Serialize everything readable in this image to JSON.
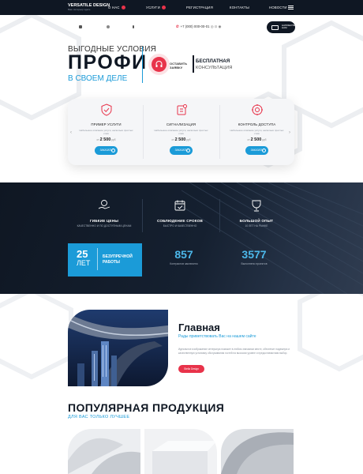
{
  "header": {
    "brand": "VERSATILE DESIGN",
    "brand_sub": "Ваш интерьер здесь",
    "nav": [
      {
        "label": "О НАС",
        "badge": true
      },
      {
        "label": "УСЛУГИ",
        "badge": true
      },
      {
        "label": "РЕГИСТРАЦИЯ",
        "badge": false
      },
      {
        "label": "КОНТАКТЫ",
        "badge": false
      },
      {
        "label": "НОВОСТИ",
        "badge": false
      }
    ],
    "phone": "+7 (000) 000-00-01",
    "mail_label": "НАПИШИТЕ НАМ"
  },
  "hero": {
    "subtitle": "ВЫГОДНЫЕ УСЛОВИЯ",
    "title": "ПРОФИ",
    "subtitle2": "В СВОЕМ ДЕЛЕ",
    "order_label": "ОСТАВИТЬ\nЗАЯВКУ",
    "consult_title": "БЕСПЛАТНАЯ",
    "consult_sub": "КОНСУЛЬТАЦИЯ"
  },
  "cards": [
    {
      "icon": "shield-check-icon",
      "name": "ПРИМЕР УСЛУГИ",
      "desc": "Небольшое описание услуги, несколько простых слов",
      "price_prefix": "от",
      "price": "2 500",
      "currency": "руб",
      "button": "ЗАКАЗАТЬ"
    },
    {
      "icon": "alarm-icon",
      "name": "СИГНАЛИЗАЦИЯ",
      "desc": "Небольшое описание услуги, несколько простых слов",
      "price_prefix": "от",
      "price": "2 500",
      "currency": "руб",
      "button": "ЗАКАЗАТЬ"
    },
    {
      "icon": "access-control-icon",
      "name": "КОНТРОЛЬ ДОСТУПА",
      "desc": "Небольшое описание услуги, несколько простых слов",
      "price_prefix": "от",
      "price": "2 500",
      "currency": "руб",
      "button": "ЗАКАЗАТЬ"
    }
  ],
  "features": [
    {
      "icon": "hand-money-icon",
      "title": "ГИБКИЕ ЦЕНЫ",
      "sub": "КАЧЕСТВЕННО И ПО ДОСТУПНЫМ ЦЕНАМ"
    },
    {
      "icon": "calendar-check-icon",
      "title": "СОБЛЮДЕНИЕ СРОКОВ",
      "sub": "БЫСТРО И КАЧЕСТВЕННО"
    },
    {
      "icon": "award-icon",
      "title": "БОЛЬШОЙ ОПЫТ",
      "sub": "10 ЛЕТ НА РЫНКЕ"
    }
  ],
  "years": {
    "number": "25",
    "label": "ЛЕТ",
    "text": "БЕЗУПРЕЧНОЙ\nРАБОТЫ"
  },
  "stats": [
    {
      "number": "857",
      "label": "Контрактов заключено"
    },
    {
      "number": "3577",
      "label": "Выполнено проектов"
    }
  ],
  "about": {
    "title": "Главная",
    "subtitle": "Рады приветствовать Вас на нашем сайте",
    "text": "Идеальное изображение интерьера поможет в любом значимом месте, обеспечит надежную и качественную установку обслуживания гостей на высоком уровне и предоставим вам выбор.",
    "button": "Stella Design"
  },
  "popular": {
    "title": "ПОПУЛЯРНАЯ ПРОДУКЦИЯ",
    "subtitle": "ДЛЯ ВАС ТОЛЬКО ЛУЧШЕЕ"
  },
  "colors": {
    "accent": "#1b9bd8",
    "brand_red": "#e8334a",
    "dark": "#0f1723"
  }
}
